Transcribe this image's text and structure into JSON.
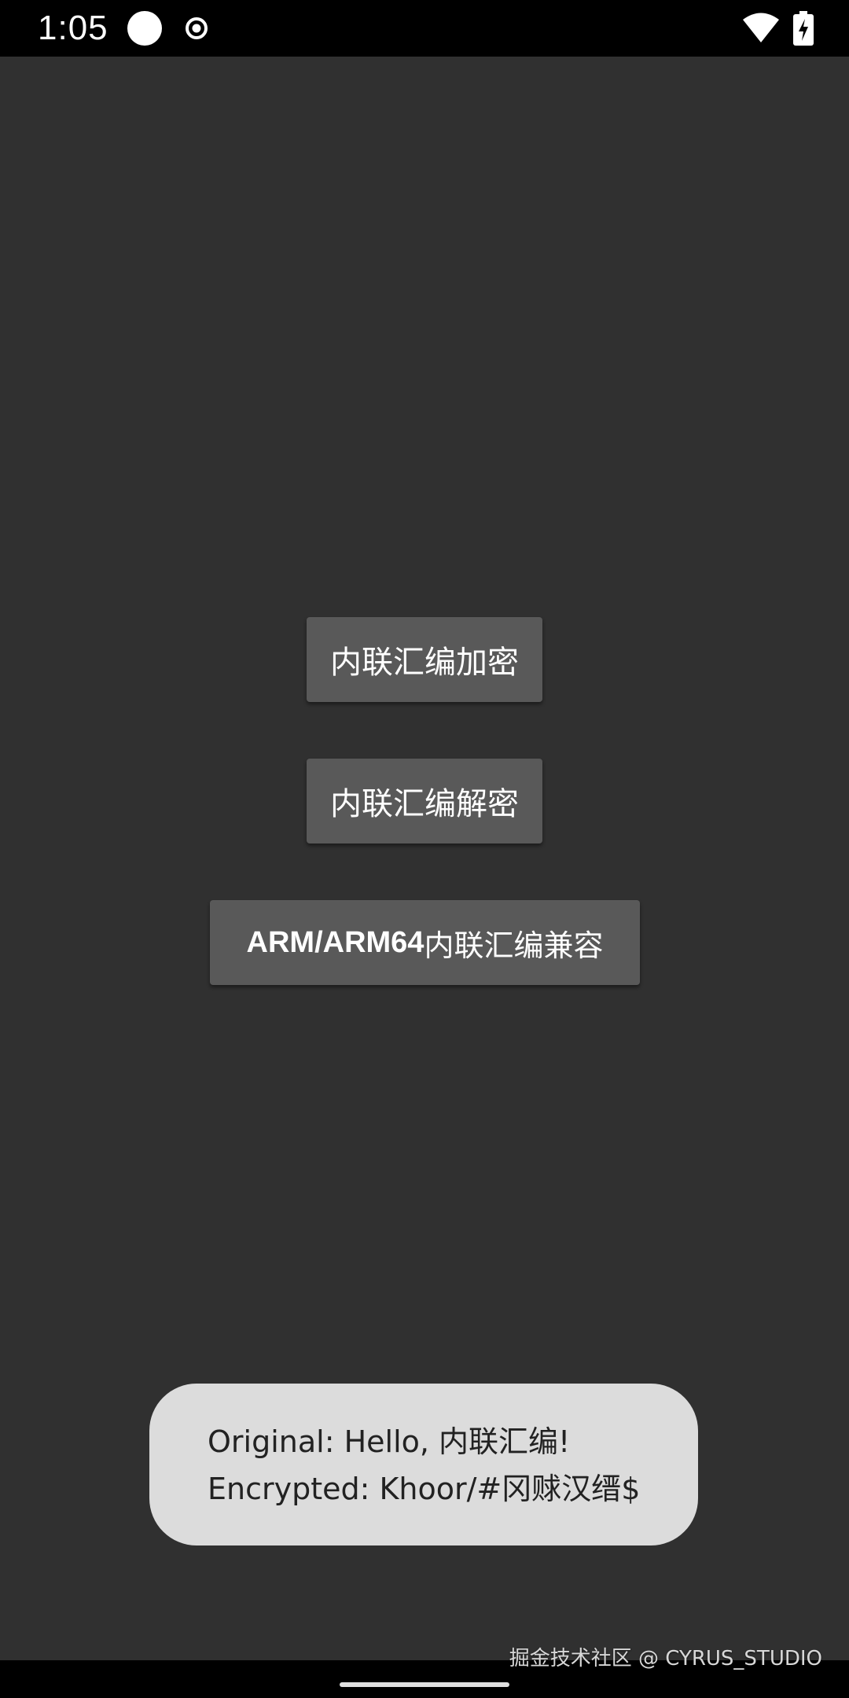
{
  "status_bar": {
    "time": "1:05",
    "icons": [
      "circle-icon",
      "target-icon",
      "wifi-icon",
      "battery-charging-icon"
    ]
  },
  "main": {
    "buttons": [
      {
        "label": "内联汇编加密"
      },
      {
        "label": "内联汇编解密"
      },
      {
        "label_latin": "ARM/ARM64",
        "label_cjk": "内联汇编兼容"
      }
    ]
  },
  "toast": {
    "line1": "Original: Hello, 内联汇编!",
    "line2": "Encrypted: Khoor/#冈赇汉缙$"
  },
  "watermark": {
    "text": "掘金技术社区 @ CYRUS_STUDIO"
  },
  "colors": {
    "background": "#303030",
    "button": "#595959",
    "toast": "#dcdcdc",
    "status_bar": "#000000"
  }
}
